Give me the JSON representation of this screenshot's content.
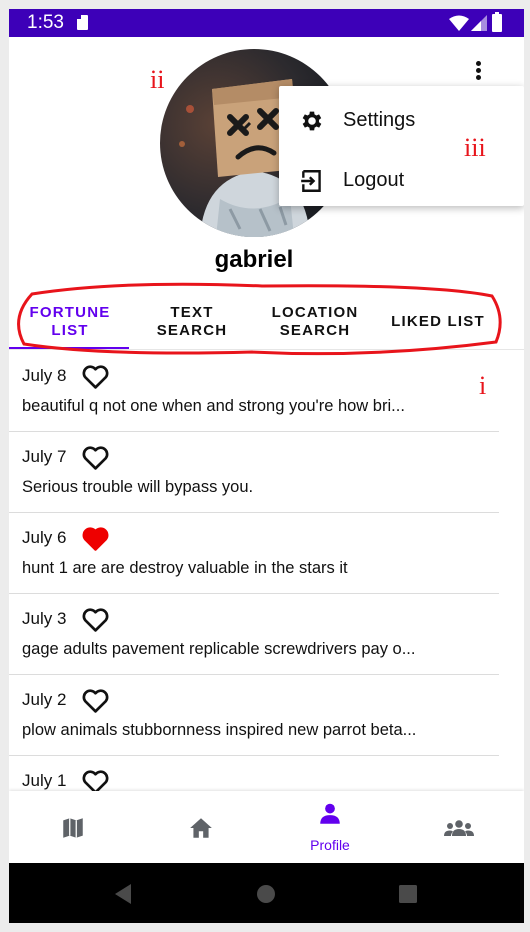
{
  "status_bar": {
    "time": "1:53"
  },
  "profile": {
    "username": "gabriel"
  },
  "menu": {
    "items": [
      {
        "label": "Settings",
        "icon": "gear-icon"
      },
      {
        "label": "Logout",
        "icon": "logout-icon"
      }
    ]
  },
  "annotations": {
    "one": "i",
    "two": "ii",
    "three": "iii"
  },
  "tabs": [
    {
      "label": "FORTUNE LIST",
      "active": true
    },
    {
      "label": "TEXT SEARCH",
      "active": false
    },
    {
      "label": "LOCATION SEARCH",
      "active": false
    },
    {
      "label": "LIKED LIST",
      "active": false
    }
  ],
  "fortunes": [
    {
      "date": "July 8",
      "text": "beautiful q not one when and strong you're how bri...",
      "liked": false
    },
    {
      "date": "July 7",
      "text": "Serious trouble will bypass you.",
      "liked": false
    },
    {
      "date": "July 6",
      "text": "hunt 1 are are destroy valuable in the stars it",
      "liked": true
    },
    {
      "date": "July 3",
      "text": "gage adults pavement replicable screwdrivers pay o...",
      "liked": false
    },
    {
      "date": "July 2",
      "text": "plow animals stubbornness inspired new parrot beta...",
      "liked": false
    },
    {
      "date": "July 1",
      "text": "",
      "liked": false
    }
  ],
  "bottom_nav": [
    {
      "icon": "map-icon",
      "label": ""
    },
    {
      "icon": "home-icon",
      "label": ""
    },
    {
      "icon": "person-icon",
      "label": "Profile",
      "active": true
    },
    {
      "icon": "group-icon",
      "label": ""
    }
  ],
  "colors": {
    "accent": "#6200ee",
    "status_bar": "#3d00b8",
    "liked": "#ee0000",
    "annotation": "#e8141b"
  }
}
